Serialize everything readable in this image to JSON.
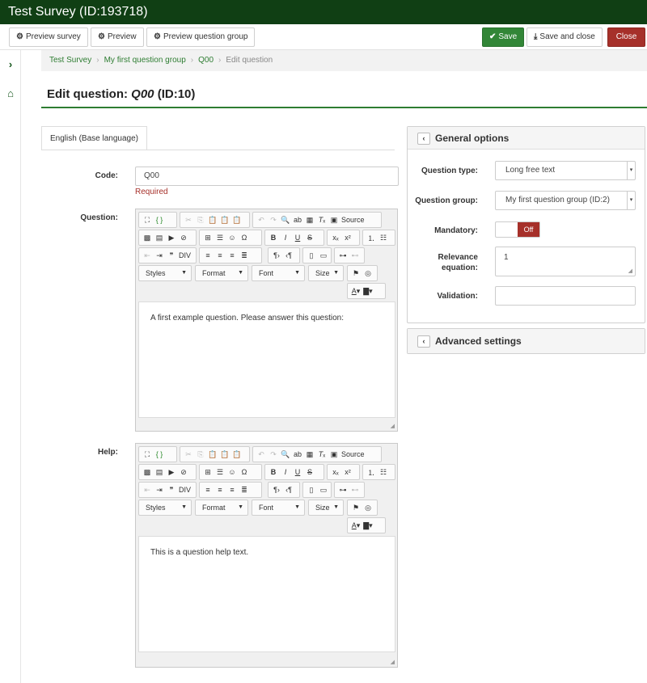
{
  "window": {
    "title": "Test Survey (ID:193718)"
  },
  "toolbar": {
    "preview_survey": "Preview survey",
    "preview": "Preview",
    "preview_group": "Preview question group",
    "save": "Save",
    "save_close": "Save and close",
    "close": "Close"
  },
  "breadcrumb": {
    "items": [
      "Test Survey",
      "My first question group",
      "Q00"
    ],
    "current": "Edit question"
  },
  "page": {
    "title_prefix": "Edit question:",
    "code": "Q00",
    "id": "(ID:10)"
  },
  "tabs": {
    "language": "English (Base language)"
  },
  "form": {
    "code_label": "Code:",
    "code_value": "Q00",
    "required": "Required",
    "question_label": "Question:",
    "help_label": "Help:"
  },
  "editor": {
    "source": "Source",
    "styles": "Styles",
    "format": "Format",
    "font": "Font",
    "size": "Size"
  },
  "question_text": "A first example question. Please answer this question:",
  "help_text": "This is a question help text.",
  "general": {
    "title": "General options",
    "type_label": "Question type:",
    "type_value": "Long free text",
    "group_label": "Question group:",
    "group_value": "My first question group (ID:2)",
    "mandatory_label": "Mandatory:",
    "mandatory_value": "Off",
    "relevance_label_1": "Relevance",
    "relevance_label_2": "equation:",
    "relevance_value": "1",
    "validation_label": "Validation:",
    "validation_value": ""
  },
  "advanced": {
    "title": "Advanced settings"
  },
  "colors": {
    "brand": "#103f14",
    "accent": "#2e7d32",
    "danger": "#a6302a"
  }
}
